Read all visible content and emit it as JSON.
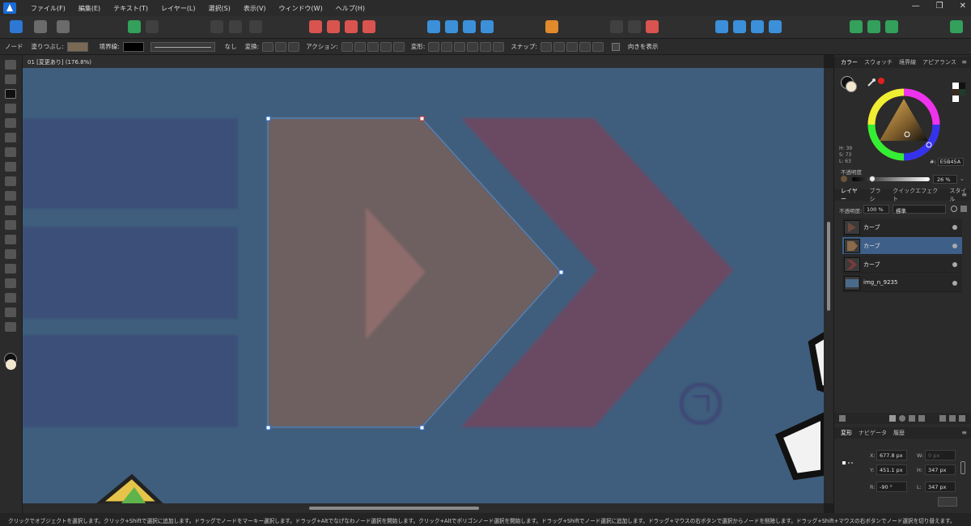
{
  "menubar": {
    "items": [
      "ファイル(F)",
      "編集(E)",
      "テキスト(T)",
      "レイヤー(L)",
      "選択(S)",
      "表示(V)",
      "ウィンドウ(W)",
      "ヘルプ(H)"
    ]
  },
  "context_toolbar": {
    "node_label": "ノード",
    "fill_label": "塗りつぶし:",
    "stroke_label": "境界線:",
    "stroke_none": "なし",
    "convert_label": "変換:",
    "action_label": "アクション:",
    "transform_label": "変形:",
    "snap_label": "スナップ:",
    "show_orientation": "向きを表示",
    "fill_color": "#7a6a55",
    "stroke_color": "#000000"
  },
  "document": {
    "tab_title": "01 [変更あり] (176.8%)"
  },
  "color_panel": {
    "tabs": [
      "カラー",
      "スウォッチ",
      "境界線",
      "アピアランス"
    ],
    "selected_tab": "カラー",
    "h": "H: 39",
    "s": "S: 73",
    "l": "L: 63",
    "hex_prefix": "#:",
    "hex": "E5B45A",
    "opacity_label": "不透明度",
    "opacity_value": "26 %",
    "opacity_fraction": 0.26
  },
  "layers_panel": {
    "tabs": [
      "レイヤー",
      "ブラシ",
      "クイックエフェクト",
      "スタイル"
    ],
    "selected_tab": "レイヤー",
    "opacity_label": "不透明度:",
    "opacity_value": "100 %",
    "blend_mode": "標準",
    "layers": [
      {
        "name": "カーブ",
        "selected": false,
        "thumb_color": "#6b4a40"
      },
      {
        "name": "カーブ",
        "selected": true,
        "thumb_color": "#8a6a4a"
      },
      {
        "name": "カーブ",
        "selected": false,
        "thumb_color": "#7a3a3a"
      },
      {
        "name": "img_n_9235",
        "selected": false,
        "thumb_color": "#4a6a8a"
      }
    ]
  },
  "transform_panel": {
    "tabs": [
      "変形",
      "ナビゲータ",
      "履歴"
    ],
    "selected_tab": "変形",
    "x_label": "X:",
    "x_value": "677.8 px",
    "y_label": "Y:",
    "y_value": "451.1 px",
    "r_label": "R:",
    "r_value": "-90 °",
    "w_label": "W:",
    "w_value": "0 px",
    "h_label": "H:",
    "h_value": "347 px",
    "l_label": "L:",
    "l_value": "347 px"
  },
  "status": {
    "text": "クリックでオブジェクトを選択します。クリック+Shiftで選択に追加します。ドラッグでノードをマーキー選択します。ドラッグ+Altでなげなわノード選択を開始します。クリック+Altでポリゴンノード選択を開始します。ドラッグ+Shiftでノード選択に追加します。ドラッグ+マウスの右ボタンで選択からノードを削除します。ドラッグ+Shift+マウスの右ボタンでノード選択を切り替えます。"
  },
  "colors": {
    "canvas_bg": "#3f5e7d",
    "shape_brown": "#6e6060",
    "shape_purple": "#6a4a64",
    "triangle_pink": "#8e6c6c",
    "rect_navy": "#3a4f78",
    "accent": "#3c8fd9"
  }
}
